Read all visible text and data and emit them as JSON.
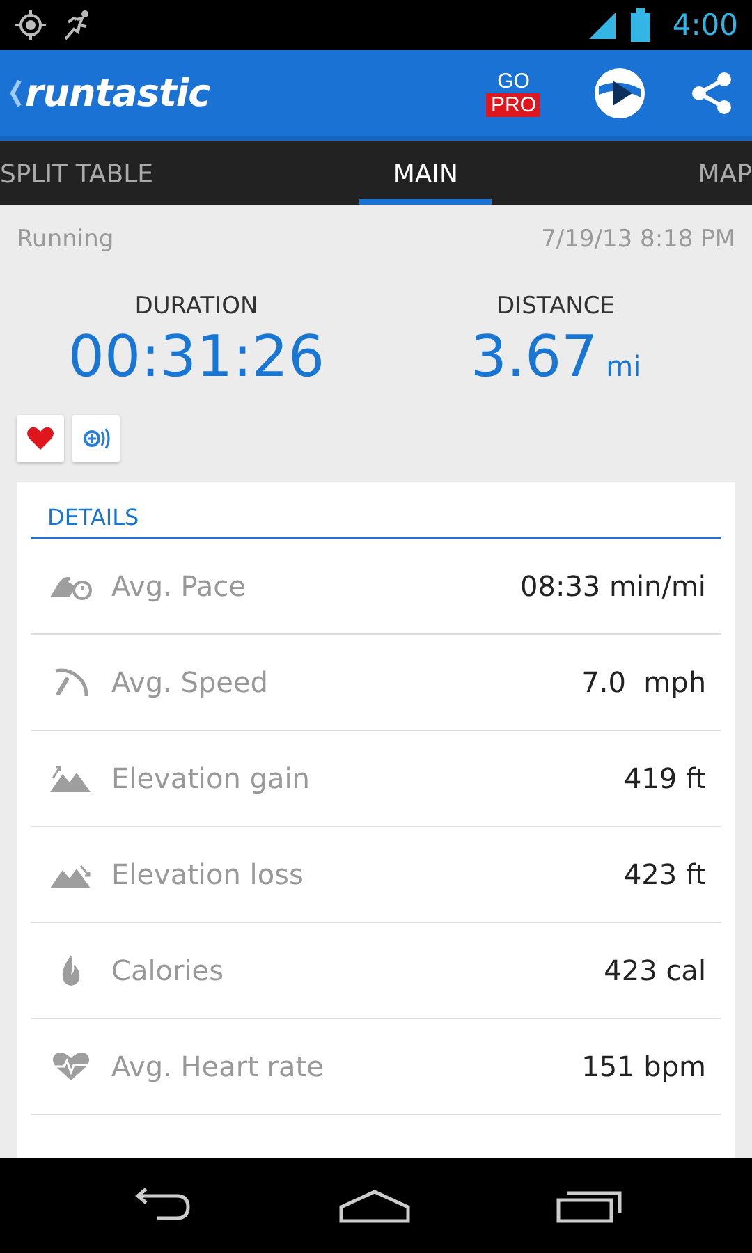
{
  "status_bar": {
    "time": "4:00"
  },
  "app_bar": {
    "logo": "runtastic",
    "go_pro": {
      "top": "GO",
      "badge": "PRO"
    }
  },
  "tabs": [
    {
      "label": "SPLIT TABLE",
      "selected": false
    },
    {
      "label": "MAIN",
      "selected": true
    },
    {
      "label": "MAP",
      "selected": false
    }
  ],
  "activity": {
    "type": "Running",
    "date": "7/19/13 8:18 PM"
  },
  "stats": [
    {
      "label": "DURATION",
      "value": "00:31:26"
    },
    {
      "label": "DISTANCE",
      "value": "3.67",
      "unit": "mi"
    }
  ],
  "details": {
    "title": "DETAILS",
    "rows": [
      {
        "kind": "pace",
        "label": "Avg. Pace",
        "value": "08:33 min/mi"
      },
      {
        "kind": "speed",
        "label": "Avg. Speed",
        "value": "7.0  mph"
      },
      {
        "kind": "elevation_gain",
        "label": "Elevation gain",
        "value": "419 ft"
      },
      {
        "kind": "elevation_loss",
        "label": "Elevation loss",
        "value": "423 ft"
      },
      {
        "kind": "calories",
        "label": "Calories",
        "value": "423 cal"
      },
      {
        "kind": "heart_rate",
        "label": "Avg. Heart rate",
        "value": "151 bpm"
      }
    ]
  }
}
